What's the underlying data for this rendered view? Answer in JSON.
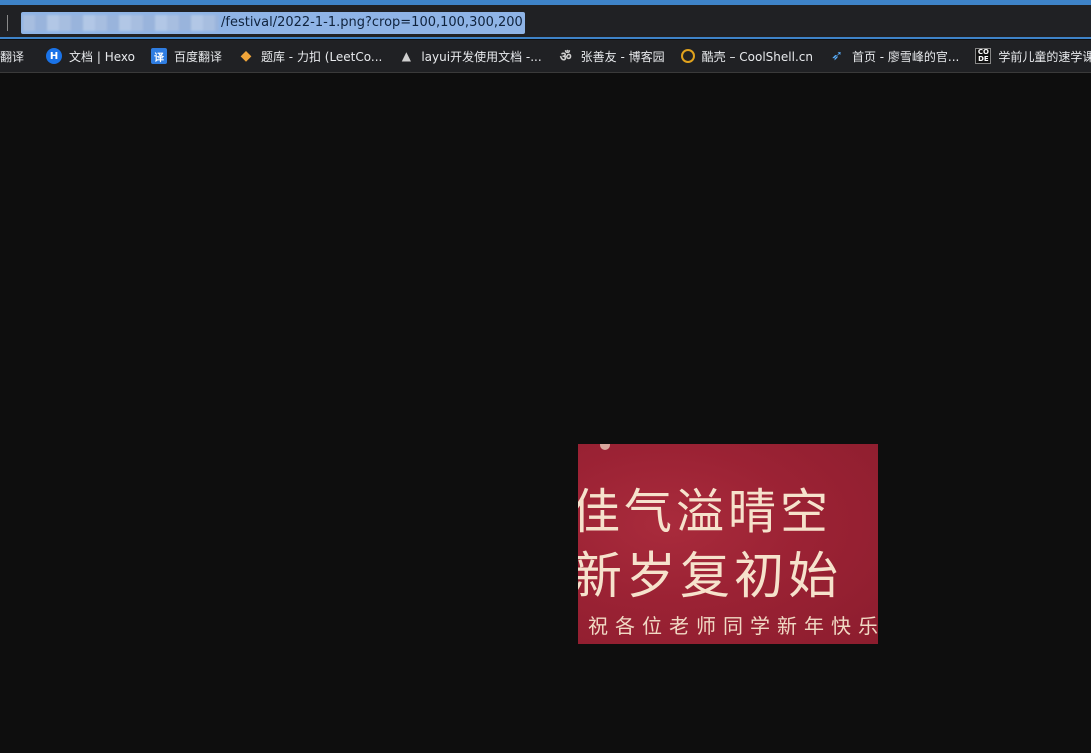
{
  "address_bar": {
    "url_visible": "/festival/2022-1-1.png?crop=100,100,300,200"
  },
  "bookmarks": [
    {
      "label": "翻译",
      "icon": "none"
    },
    {
      "label": "文档 | Hexo",
      "icon": "hexo-icon"
    },
    {
      "label": "百度翻译",
      "icon": "baidu-translate-icon"
    },
    {
      "label": "题库 - 力扣 (LeetCo...",
      "icon": "leetcode-icon"
    },
    {
      "label": "layui开发使用文档 -...",
      "icon": "layui-icon"
    },
    {
      "label": "张善友 - 博客园",
      "icon": "cnblogs-icon"
    },
    {
      "label": "酷壳 – CoolShell.cn",
      "icon": "coolshell-icon"
    },
    {
      "label": "首页 - 廖雪峰的官...",
      "icon": "rocket-icon"
    },
    {
      "label": "学前儿童的速学课...",
      "icon": "code-icon"
    }
  ],
  "image": {
    "line1": "佳气溢晴空",
    "line2": "新岁复初始",
    "line3": "祝各位老师同学新年快乐"
  },
  "colors": {
    "accent": "#3e83c8",
    "image_bg": "#9b2234",
    "image_text": "#f6e2cc"
  }
}
